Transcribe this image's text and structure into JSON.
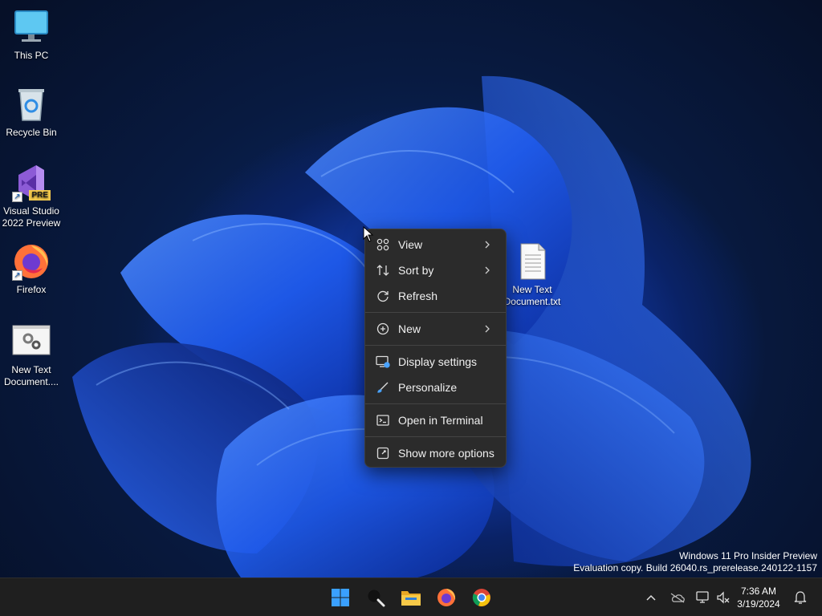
{
  "desktop_icons": [
    {
      "label": "This PC"
    },
    {
      "label": "Recycle Bin"
    },
    {
      "label": "Visual Studio 2022 Preview",
      "badge": "PRE"
    },
    {
      "label": "Firefox"
    },
    {
      "label": "New Text Document...."
    },
    {
      "label": "New Text Document.txt"
    }
  ],
  "context_menu": {
    "items": [
      {
        "label": "View",
        "icon": "grid-view-icon",
        "has_submenu": true
      },
      {
        "label": "Sort by",
        "icon": "sort-icon",
        "has_submenu": true
      },
      {
        "label": "Refresh",
        "icon": "refresh-icon",
        "has_submenu": false
      },
      {
        "label": "New",
        "icon": "plus-circle-icon",
        "has_submenu": true
      },
      {
        "label": "Display settings",
        "icon": "display-settings-icon",
        "has_submenu": false
      },
      {
        "label": "Personalize",
        "icon": "brush-icon",
        "has_submenu": false
      },
      {
        "label": "Open in Terminal",
        "icon": "terminal-icon",
        "has_submenu": false
      },
      {
        "label": "Show more options",
        "icon": "show-more-icon",
        "has_submenu": false
      }
    ]
  },
  "watermark": {
    "line1": "Windows 11 Pro Insider Preview",
    "line2": "Evaluation copy. Build 26040.rs_prerelease.240122-1157"
  },
  "taskbar": {
    "apps": [
      "start-icon",
      "search-icon",
      "file-explorer-icon",
      "firefox-icon",
      "chrome-icon"
    ],
    "tray": [
      "chevron-up-icon",
      "onedrive-icon",
      "network-icon",
      "volume-muted-icon",
      "notification-bell-icon"
    ],
    "clock": {
      "time": "7:36 AM",
      "date": "3/19/2024"
    }
  },
  "colors": {
    "menu_bg": "#2b2b2b",
    "taskbar_bg": "#1f1f1f",
    "accent_blue": "#1c54e0"
  }
}
